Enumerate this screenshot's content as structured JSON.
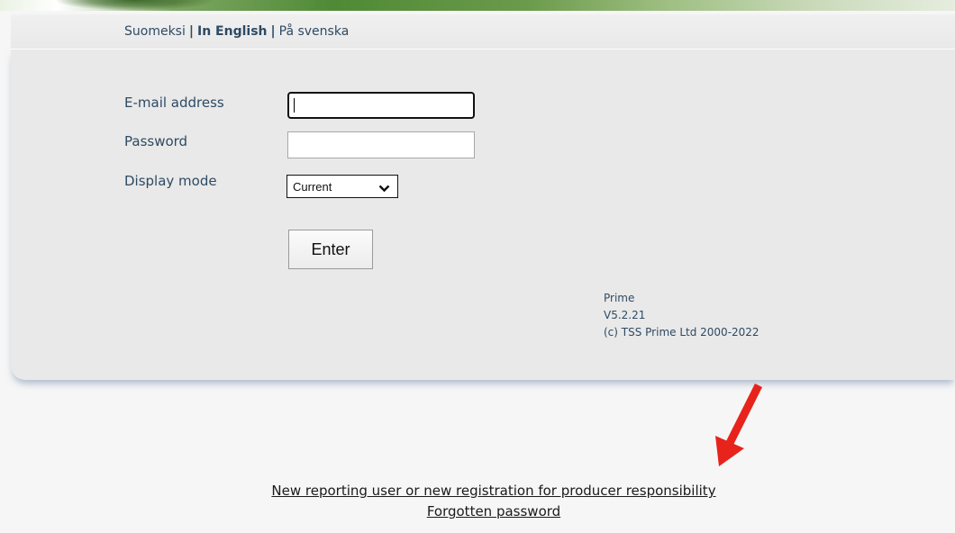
{
  "languages": {
    "finnish": "Suomeksi",
    "english": "In English",
    "swedish": "På svenska",
    "separator": "|"
  },
  "form": {
    "email_label": "E-mail address",
    "email_value": "",
    "password_label": "Password",
    "password_value": "",
    "display_mode_label": "Display mode",
    "display_mode_selected": "Current",
    "enter_label": "Enter"
  },
  "version": {
    "product": "Prime",
    "number": "V5.2.21",
    "copyright": "(c) TSS Prime Ltd 2000-2022"
  },
  "links": {
    "new_user": "New reporting user or new registration for producer responsibility",
    "forgotten_password": "Forgotten password"
  },
  "colors": {
    "text_blue": "#2e4a63",
    "arrow_red": "#e8231c",
    "banner_green": "#4f8a35"
  }
}
